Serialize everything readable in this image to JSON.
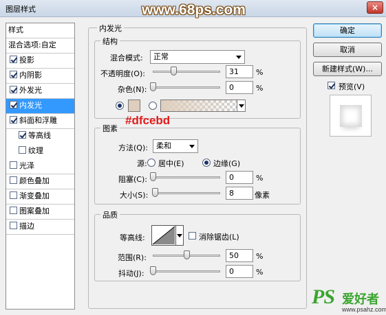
{
  "window": {
    "title": "图层样式",
    "watermark": "www.68ps.com",
    "close_glyph": "×"
  },
  "styles_list": {
    "header": "样式",
    "blend_options": "混合选项:自定",
    "items": [
      {
        "label": "投影",
        "checked": true
      },
      {
        "label": "内阴影",
        "checked": true
      },
      {
        "label": "外发光",
        "checked": true
      },
      {
        "label": "内发光",
        "checked": true,
        "selected": true
      },
      {
        "label": "斜面和浮雕",
        "checked": true
      },
      {
        "label": "等高线",
        "checked": true,
        "sub": true
      },
      {
        "label": "纹理",
        "checked": false,
        "sub": true
      },
      {
        "label": "光泽",
        "checked": false
      },
      {
        "label": "颜色叠加",
        "checked": false
      },
      {
        "label": "渐变叠加",
        "checked": false
      },
      {
        "label": "图案叠加",
        "checked": false
      },
      {
        "label": "描边",
        "checked": false
      }
    ]
  },
  "panel": {
    "title": "内发光",
    "structure": {
      "legend": "结构",
      "blend_mode_label": "混合模式:",
      "blend_mode_value": "正常",
      "opacity_label": "不透明度(O):",
      "opacity_value": "31",
      "opacity_fraction": 0.31,
      "noise_label": "杂色(N):",
      "noise_value": "0",
      "noise_fraction": 0,
      "unit": "%",
      "glow_color": "#dfcebd"
    },
    "annotation": "#dfcebd",
    "elements": {
      "legend": "图素",
      "method_label": "方法(Q):",
      "method_value": "柔和",
      "source_label": "源:",
      "source_center": "居中(E)",
      "source_edge": "边缘(G)",
      "choke_label": "阻塞(C):",
      "choke_value": "0",
      "choke_fraction": 0,
      "size_label": "大小(S):",
      "size_value": "8",
      "size_fraction": 0.032,
      "size_unit": "像素",
      "unit": "%"
    },
    "quality": {
      "legend": "品质",
      "contour_label": "等高线:",
      "antialias_label": "消除锯齿(L)",
      "range_label": "范围(R):",
      "range_value": "50",
      "range_fraction": 0.5,
      "jitter_label": "抖动(J):",
      "jitter_value": "0",
      "jitter_fraction": 0,
      "unit": "%"
    }
  },
  "buttons": {
    "ok": "确定",
    "cancel": "取消",
    "new_style": "新建样式(W)...",
    "preview_label": "预览(V)"
  },
  "logo": {
    "ps": "PS",
    "cn": "爱好者",
    "url": "www.psahz.com"
  }
}
